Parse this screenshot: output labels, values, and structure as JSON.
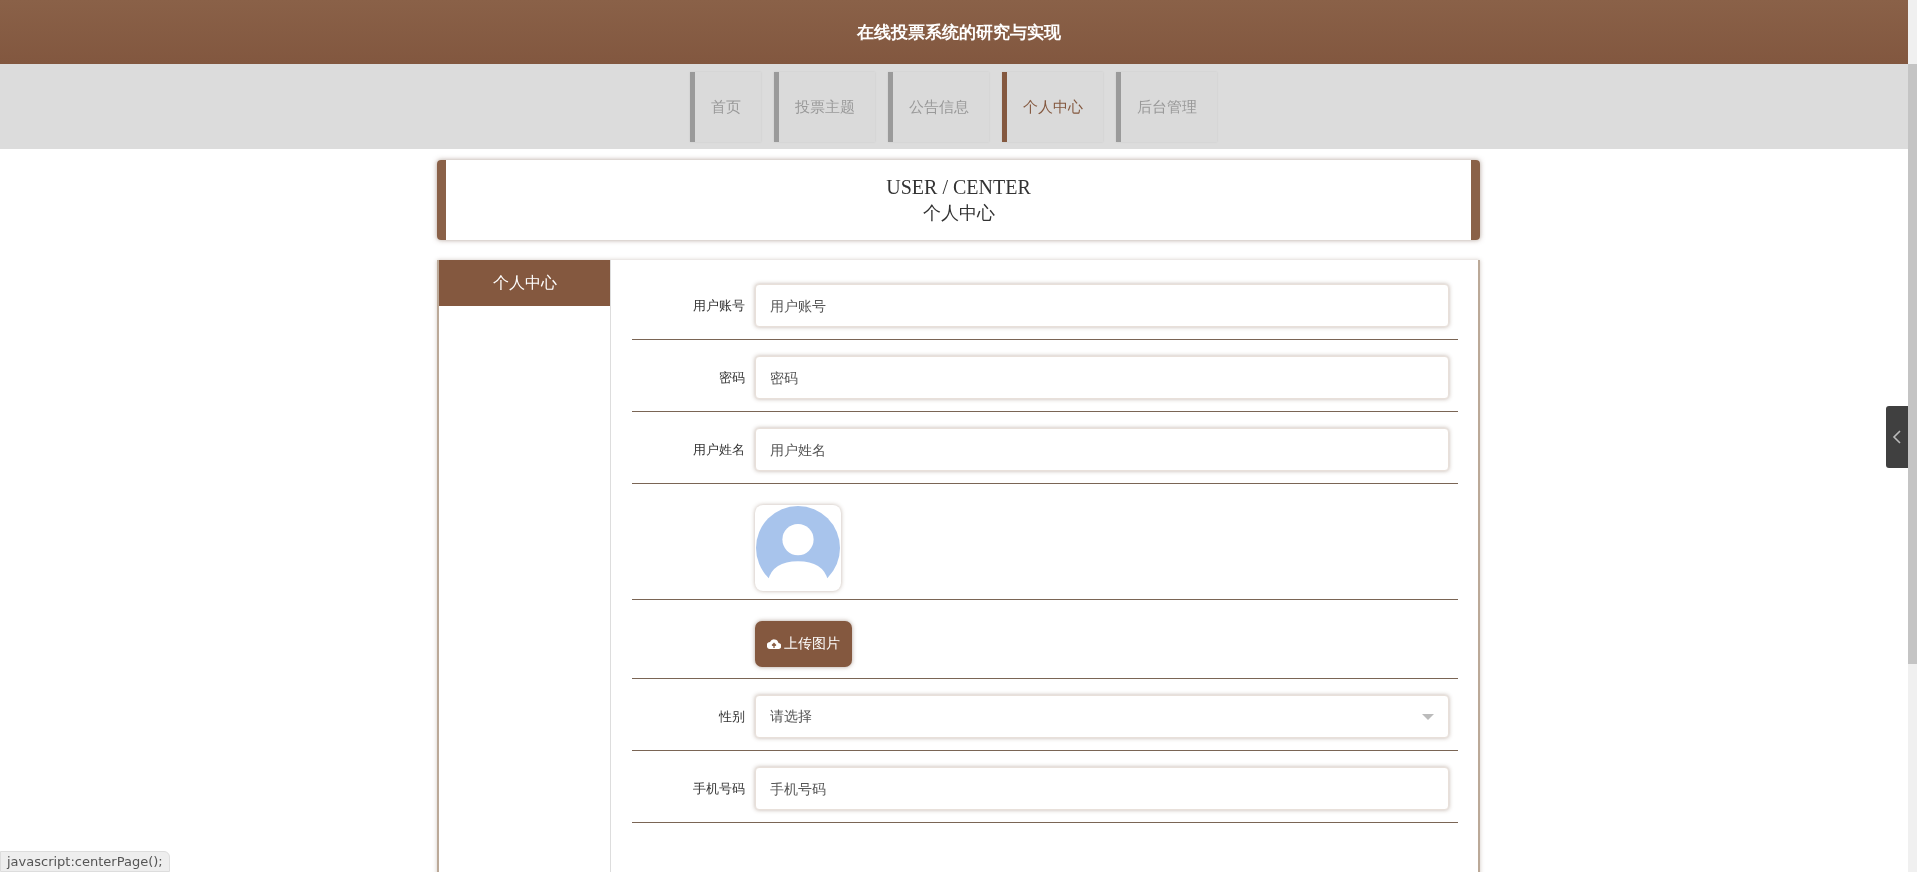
{
  "header": {
    "title": "在线投票系统的研究与实现"
  },
  "nav": [
    {
      "label": "首页",
      "selected": false
    },
    {
      "label": "投票主题",
      "selected": false
    },
    {
      "label": "公告信息",
      "selected": false
    },
    {
      "label": "个人中心",
      "selected": true
    },
    {
      "label": "后台管理",
      "selected": false
    }
  ],
  "page_title": {
    "english": "USER / CENTER",
    "chinese": "个人中心"
  },
  "sidebar": {
    "items": [
      {
        "label": "个人中心",
        "selected": true
      }
    ]
  },
  "form": {
    "rows": [
      {
        "kind": "input",
        "label": "用户账号",
        "placeholder": "用户账号"
      },
      {
        "kind": "input",
        "label": "密码",
        "placeholder": "密码"
      },
      {
        "kind": "input",
        "label": "用户姓名",
        "placeholder": "用户姓名"
      },
      {
        "kind": "avatar"
      },
      {
        "kind": "upload",
        "button": "上传图片"
      },
      {
        "kind": "select",
        "label": "性别",
        "placeholder": "请选择"
      },
      {
        "kind": "input",
        "label": "手机号码",
        "placeholder": "手机号码"
      }
    ]
  },
  "status_bar": {
    "text": "javascript:centerPage();"
  }
}
